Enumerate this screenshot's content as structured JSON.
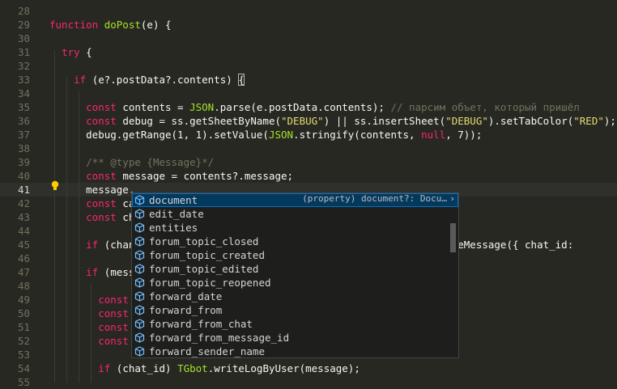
{
  "top_partial": "...........................................",
  "lines": [
    {
      "num": "28",
      "tokens": []
    },
    {
      "num": "29",
      "tokens": [
        [
          "k",
          "function "
        ],
        [
          "f",
          "doPost"
        ],
        [
          "",
          "(e) {"
        ]
      ]
    },
    {
      "num": "30",
      "tokens": []
    },
    {
      "num": "31",
      "tokens": [
        [
          "",
          "  "
        ],
        [
          "k",
          "try"
        ],
        [
          "",
          " {"
        ]
      ]
    },
    {
      "num": "32",
      "tokens": []
    },
    {
      "num": "33",
      "tokens": [
        [
          "",
          "    "
        ],
        [
          "k",
          "if"
        ],
        [
          "",
          " (e?.postData?.contents) "
        ],
        [
          "br",
          "{"
        ]
      ]
    },
    {
      "num": "34",
      "tokens": []
    },
    {
      "num": "35",
      "tokens": [
        [
          "",
          "      "
        ],
        [
          "k",
          "const"
        ],
        [
          "",
          " contents = "
        ],
        [
          "f",
          "JSON"
        ],
        [
          "",
          ".parse(e.postData.contents); "
        ],
        [
          "c",
          "// парсим объет, который пришёл"
        ]
      ]
    },
    {
      "num": "36",
      "tokens": [
        [
          "",
          "      "
        ],
        [
          "k",
          "const"
        ],
        [
          "",
          " debug = ss.getSheetByName("
        ],
        [
          "s",
          "\"DEBUG\""
        ],
        [
          "",
          ") || ss.insertSheet("
        ],
        [
          "s",
          "\"DEBUG\""
        ],
        [
          "",
          ").setTabColor("
        ],
        [
          "s",
          "\"RED\""
        ],
        [
          "",
          ");"
        ]
      ]
    },
    {
      "num": "37",
      "tokens": [
        [
          "",
          "      debug.getRange(1, 1).setValue("
        ],
        [
          "f",
          "JSON"
        ],
        [
          "",
          ".stringify(contents, "
        ],
        [
          "k",
          "null"
        ],
        [
          "",
          ", 7));"
        ]
      ]
    },
    {
      "num": "38",
      "tokens": []
    },
    {
      "num": "39",
      "tokens": [
        [
          "",
          "      "
        ],
        [
          "c",
          "/** @type {Message}*/"
        ]
      ]
    },
    {
      "num": "40",
      "tokens": [
        [
          "",
          "      "
        ],
        [
          "k",
          "const"
        ],
        [
          "",
          " message = contents?.message;"
        ]
      ]
    },
    {
      "num": "41",
      "tokens": [
        [
          "",
          "      message."
        ]
      ]
    },
    {
      "num": "42",
      "tokens": [
        [
          "",
          "      "
        ],
        [
          "k",
          "const"
        ],
        [
          "",
          " ca"
        ]
      ]
    },
    {
      "num": "43",
      "tokens": [
        [
          "",
          "      "
        ],
        [
          "k",
          "const"
        ],
        [
          "",
          " ch"
        ]
      ]
    },
    {
      "num": "44",
      "tokens": []
    },
    {
      "num": "45",
      "tokens": [
        [
          "",
          "      "
        ],
        [
          "k",
          "if"
        ],
        [
          "",
          " (chan                                             "
        ],
        [
          "",
          "ot.deleteMessage({ chat_id:"
        ]
      ]
    },
    {
      "num": "46",
      "tokens": []
    },
    {
      "num": "47",
      "tokens": [
        [
          "",
          "      "
        ],
        [
          "k",
          "if"
        ],
        [
          "",
          " (mess"
        ]
      ]
    },
    {
      "num": "48",
      "tokens": []
    },
    {
      "num": "49",
      "tokens": [
        [
          "",
          "        "
        ],
        [
          "k",
          "const"
        ]
      ]
    },
    {
      "num": "50",
      "tokens": [
        [
          "",
          "        "
        ],
        [
          "k",
          "const"
        ]
      ]
    },
    {
      "num": "51",
      "tokens": [
        [
          "",
          "        "
        ],
        [
          "k",
          "const"
        ]
      ]
    },
    {
      "num": "52",
      "tokens": [
        [
          "",
          "        "
        ],
        [
          "k",
          "const"
        ]
      ]
    },
    {
      "num": "53",
      "tokens": []
    },
    {
      "num": "54",
      "tokens": [
        [
          "",
          "        "
        ],
        [
          "k",
          "if"
        ],
        [
          "",
          " (chat_id) "
        ],
        [
          "f",
          "TGbot"
        ],
        [
          "",
          ".writeLogByUser(message);"
        ]
      ]
    },
    {
      "num": "55",
      "tokens": []
    }
  ],
  "current_line": "41",
  "suggest": {
    "selected_detail": "(property) document?: Docu…",
    "more_icon": "chevron-right-icon",
    "items": [
      {
        "label": "document",
        "match": "",
        "icon": "property-icon"
      },
      {
        "label": "edit_date",
        "match": "",
        "icon": "property-icon"
      },
      {
        "label": "entities",
        "match": "",
        "icon": "property-icon"
      },
      {
        "label": "forum_topic_closed",
        "match": "",
        "icon": "property-icon"
      },
      {
        "label": "forum_topic_created",
        "match": "",
        "icon": "property-icon"
      },
      {
        "label": "forum_topic_edited",
        "match": "",
        "icon": "property-icon"
      },
      {
        "label": "forum_topic_reopened",
        "match": "",
        "icon": "property-icon"
      },
      {
        "label": "forward_date",
        "match": "",
        "icon": "property-icon"
      },
      {
        "label": "forward_from",
        "match": "",
        "icon": "property-icon"
      },
      {
        "label": "forward_from_chat",
        "match": "",
        "icon": "property-icon"
      },
      {
        "label": "forward_from_message_id",
        "match": "",
        "icon": "property-icon"
      },
      {
        "label": "forward_sender_name",
        "match": "",
        "icon": "property-icon"
      }
    ]
  },
  "colors": {
    "background": "#272822",
    "keyword": "#f92672",
    "function": "#a6e22e",
    "string": "#e6db74",
    "comment": "#75715e",
    "selection": "#04395e"
  }
}
